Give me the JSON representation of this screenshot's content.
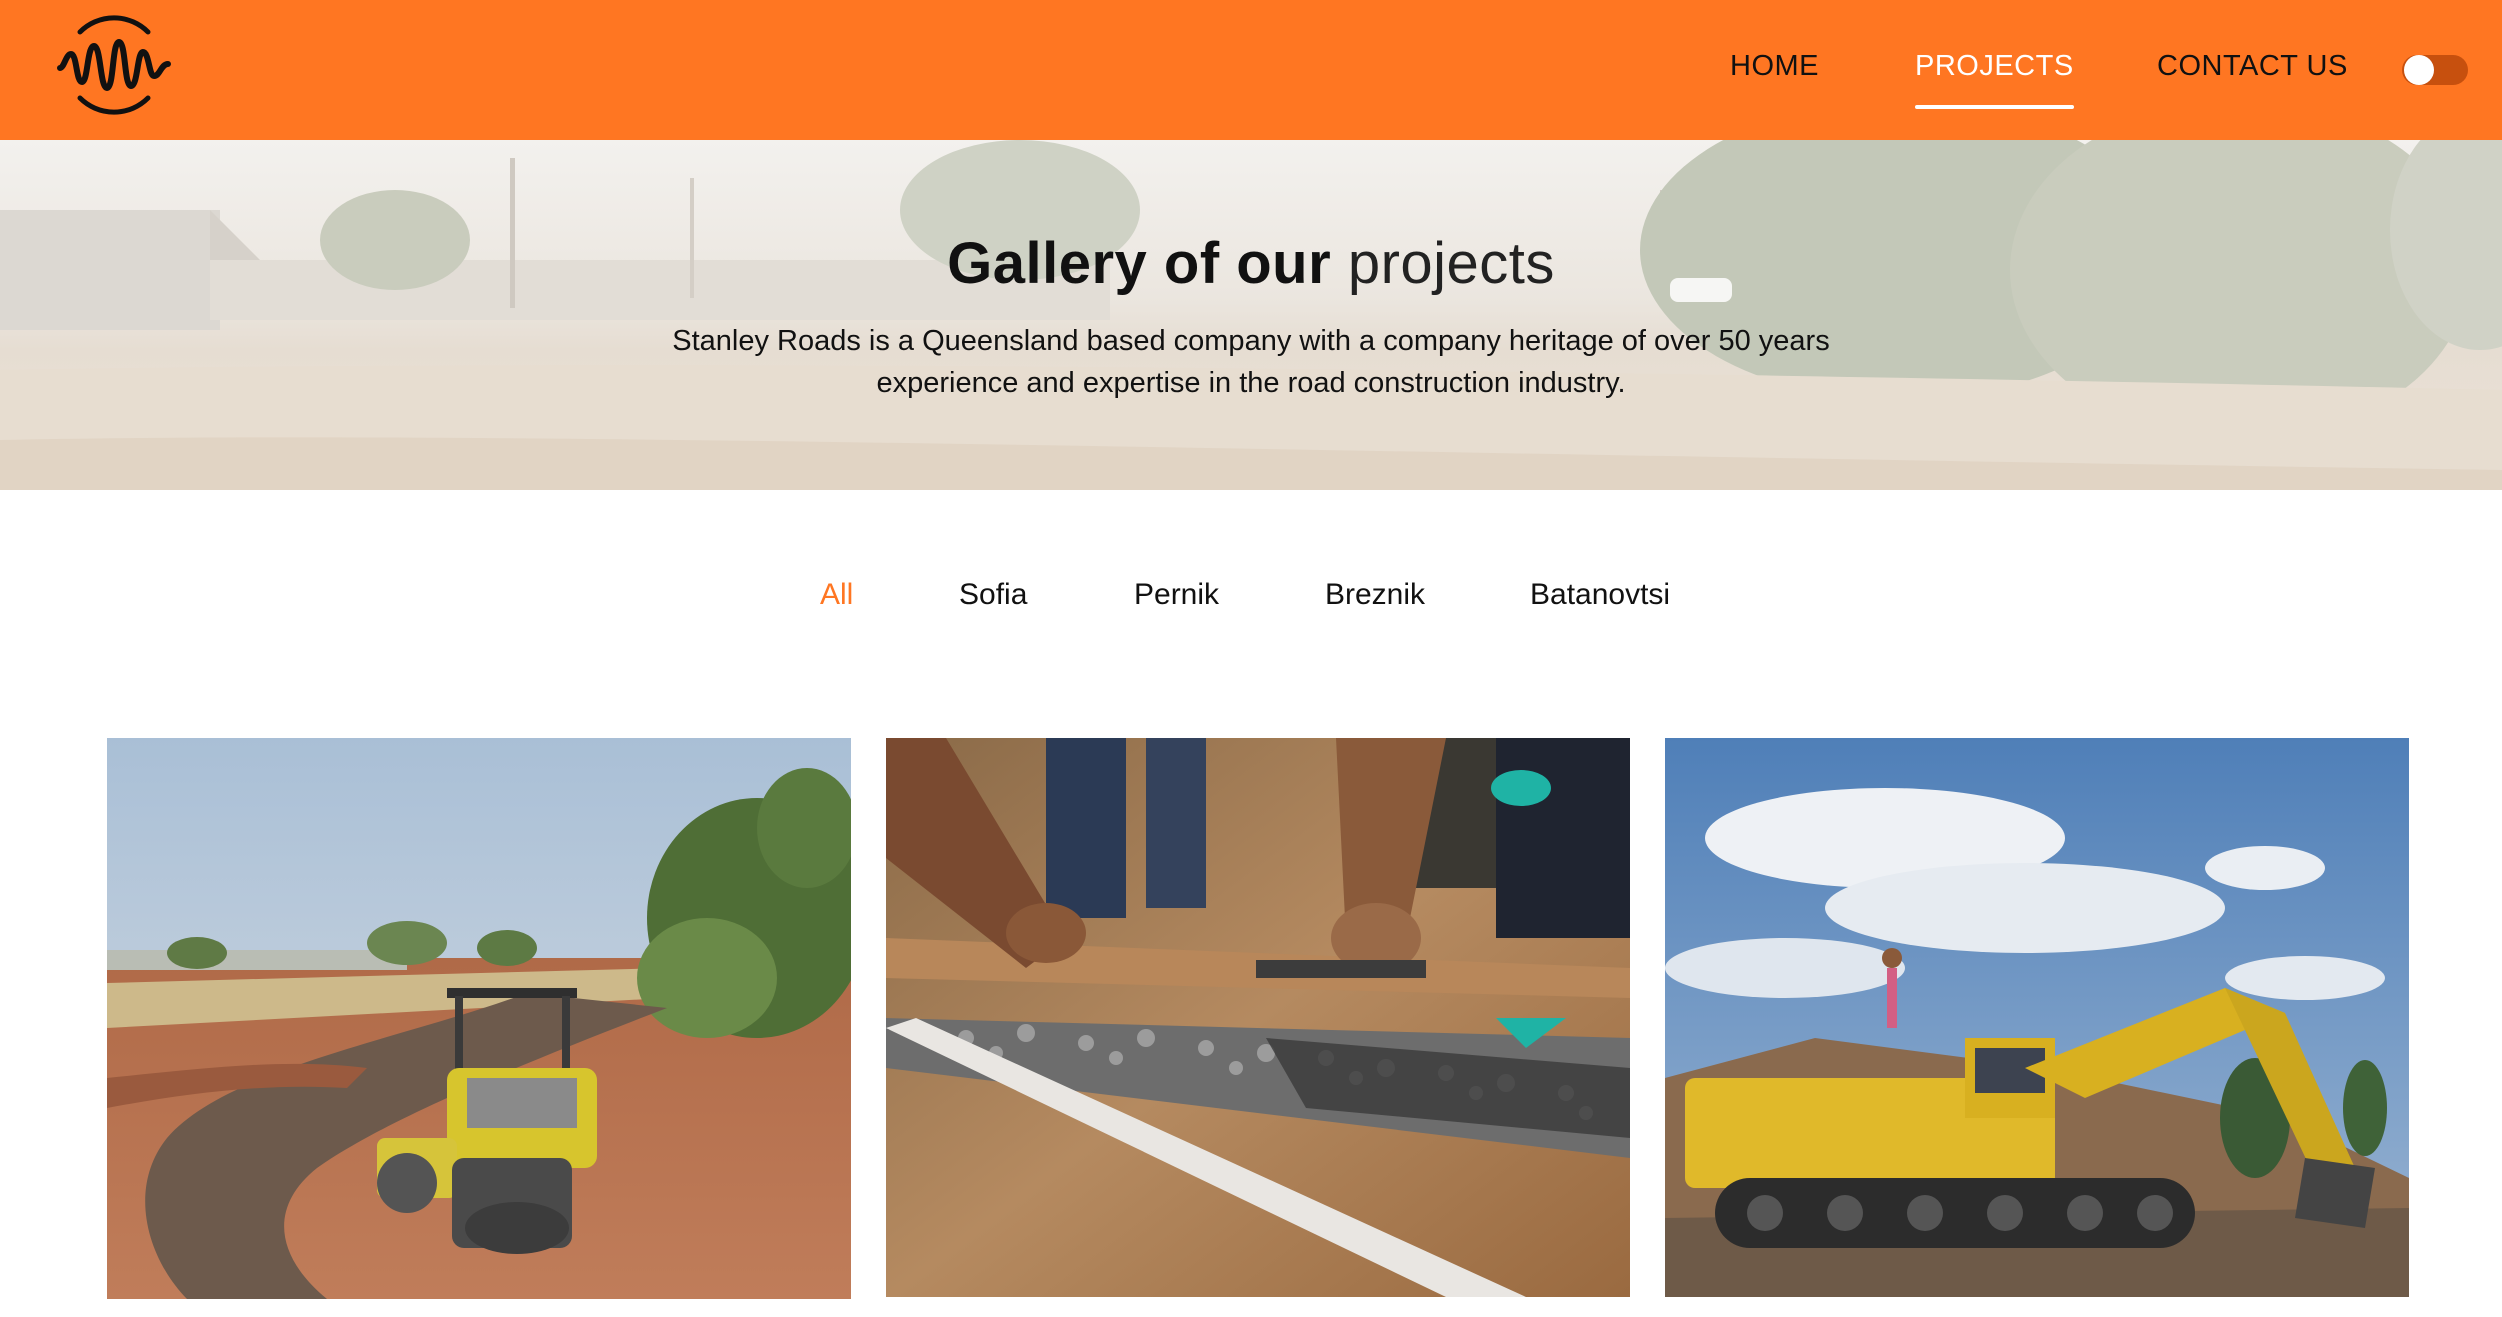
{
  "header": {
    "logo_icon": "waveform-circle-logo",
    "nav": {
      "home": "HOME",
      "projects": "PROJECTS",
      "contact": "CONTACT US"
    },
    "active_nav": "projects",
    "theme_toggle": "off"
  },
  "hero": {
    "title_main": "Gallery of our",
    "title_light": "projects",
    "description": "Stanley Roads is a Queensland based company with a company heritage of over 50 years experience and expertise in the road construction industry."
  },
  "filters": {
    "tabs": [
      "All",
      "Sofia",
      "Pernik",
      "Breznik",
      "Batanovtsi"
    ],
    "active": "All"
  },
  "colors": {
    "accent": "#ff7622",
    "text": "#111111",
    "background": "#ffffff"
  }
}
